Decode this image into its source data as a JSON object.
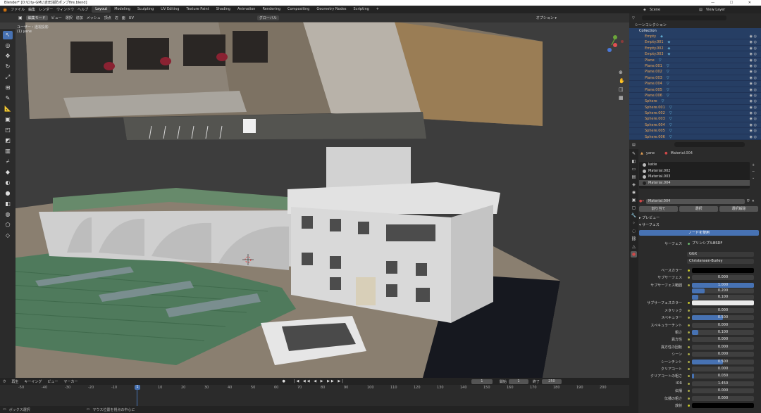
{
  "window": {
    "title": "Blender* [D:\\City-GML\\吉田消防ポンプfire.blend]",
    "controls": "— ☐ ✕"
  },
  "menu": [
    "ファイル",
    "編集",
    "レンダー",
    "ウィンドウ",
    "ヘルプ"
  ],
  "workspaces": [
    "Layout",
    "Modeling",
    "Sculpting",
    "UV Editing",
    "Texture Paint",
    "Shading",
    "Animation",
    "Rendering",
    "Compositing",
    "Geometry Nodes",
    "Scripting",
    "+"
  ],
  "active_workspace": "Layout",
  "scene": {
    "scene_label": "Scene",
    "view_layer": "View Layer"
  },
  "viewport_header": {
    "mode": "編集モード",
    "items": [
      "ビュー",
      "選択",
      "追加",
      "メッシュ",
      "頂点",
      "辺",
      "面",
      "UV"
    ],
    "transform": "グローバル",
    "options": "オプション ▾"
  },
  "viewport_overlay_text": [
    "ユーザー・透視投影",
    "(1) yane"
  ],
  "outliner": {
    "title": "シーンコレクション",
    "collection": "Collection",
    "items": [
      "Empty",
      "Empty.001",
      "Empty.002",
      "Empty.003",
      "Plane",
      "Plane.001",
      "Plane.002",
      "Plane.003",
      "Plane.004",
      "Plane.005",
      "Plane.006",
      "Sphere",
      "Sphere.001",
      "Sphere.002",
      "Sphere.003",
      "Sphere.004",
      "Sphere.005",
      "Sphere.006"
    ]
  },
  "properties": {
    "object": "yane",
    "material_slot": "Material.004",
    "materials": [
      "katie",
      "Material.002",
      "Material.003",
      "Material.004"
    ],
    "selected_material": "Material.004",
    "material_name": "Material.004",
    "buttons": {
      "assign": "割り当て",
      "select": "選択",
      "deselect": "選択解除"
    },
    "sections": {
      "preview": "プレビュー",
      "surface": "サーフェス"
    },
    "use_nodes": "ノードを使用",
    "surface_label": "サーフェス",
    "surface_value": "プリンシプルBSDF",
    "distribution": "GGX",
    "subsurface_method": "Christensen-Burley",
    "params": [
      {
        "label": "ベースカラー",
        "value": "",
        "kind": "color-black"
      },
      {
        "label": "サブサーフェス",
        "value": "0.000",
        "kind": "num"
      },
      {
        "label": "サブサーフェス範囲",
        "value": "1.000",
        "kind": "num"
      },
      {
        "label": "",
        "value": "0.200",
        "kind": "num"
      },
      {
        "label": "",
        "value": "0.100",
        "kind": "num"
      },
      {
        "label": "サブサーフェスカラー",
        "value": "",
        "kind": "color-white"
      },
      {
        "label": "メタリック",
        "value": "0.000",
        "kind": "num"
      },
      {
        "label": "スペキュラー",
        "value": "0.500",
        "kind": "num"
      },
      {
        "label": "スペキュラーチント",
        "value": "0.000",
        "kind": "num"
      },
      {
        "label": "粗さ",
        "value": "0.100",
        "kind": "num"
      },
      {
        "label": "異方性",
        "value": "0.000",
        "kind": "num"
      },
      {
        "label": "異方性の回転",
        "value": "0.000",
        "kind": "num"
      },
      {
        "label": "シーン",
        "value": "0.000",
        "kind": "num"
      },
      {
        "label": "シーンチント",
        "value": "0.500",
        "kind": "num"
      },
      {
        "label": "クリアコート",
        "value": "0.000",
        "kind": "num"
      },
      {
        "label": "クリアコートの粗さ",
        "value": "0.030",
        "kind": "num"
      },
      {
        "label": "IOR",
        "value": "1.450",
        "kind": "num"
      },
      {
        "label": "伝播",
        "value": "0.000",
        "kind": "num"
      },
      {
        "label": "伝播の粗さ",
        "value": "0.000",
        "kind": "num"
      },
      {
        "label": "放射",
        "value": "",
        "kind": "color-black"
      }
    ]
  },
  "timeline": {
    "menus": [
      "再生",
      "キーイング",
      "ビュー",
      "マーカー"
    ],
    "current_frame": "1",
    "start_label": "開始",
    "start": "1",
    "end_label": "終了",
    "end": "250",
    "ticks": [
      "-50",
      "-40",
      "-30",
      "-20",
      "-10",
      "0",
      "10",
      "20",
      "30",
      "40",
      "50",
      "60",
      "70",
      "80",
      "90",
      "100",
      "110",
      "120",
      "130",
      "140",
      "150",
      "160",
      "170",
      "180",
      "190",
      "200"
    ],
    "playhead": "1"
  },
  "status": {
    "left": "ボックス選択",
    "middle": "マウス位置を視点の中心に"
  },
  "colors": {
    "accent": "#4772b3",
    "selected_row": "#263e64",
    "orange_text": "#e8a356",
    "panel": "#2b2b2b"
  }
}
